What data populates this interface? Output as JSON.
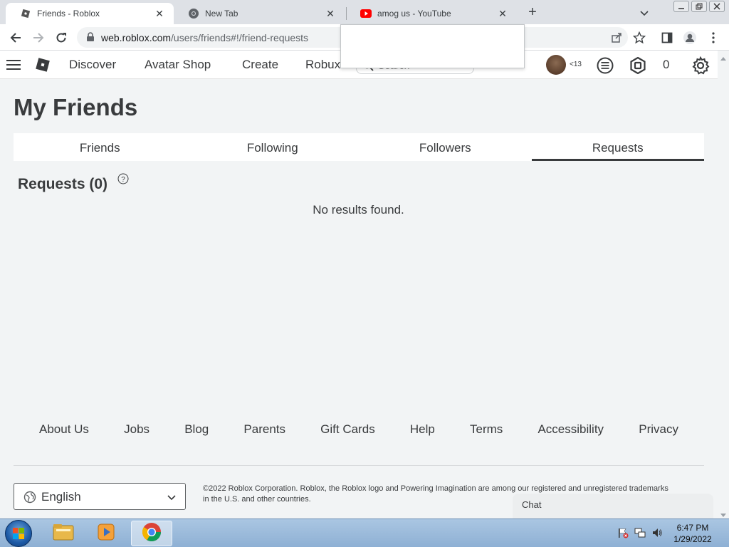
{
  "browser": {
    "tabs": [
      {
        "title": "Friends - Roblox",
        "active": true
      },
      {
        "title": "New Tab",
        "active": false
      },
      {
        "title": "amog us - YouTube",
        "active": false
      }
    ],
    "url_host": "web.roblox.com",
    "url_path": "/users/friends#!/friend-requests"
  },
  "header": {
    "nav": [
      "Discover",
      "Avatar Shop",
      "Create",
      "Robux"
    ],
    "search_placeholder": "Search",
    "age_label": "<13",
    "robux_count": "0"
  },
  "main": {
    "page_title": "My Friends",
    "tabs": [
      {
        "label": "Friends",
        "active": false
      },
      {
        "label": "Following",
        "active": false
      },
      {
        "label": "Followers",
        "active": false
      },
      {
        "label": "Requests",
        "active": true
      }
    ],
    "section_title": "Requests (0)",
    "empty_message": "No results found."
  },
  "footer": {
    "links": [
      "About Us",
      "Jobs",
      "Blog",
      "Parents",
      "Gift Cards",
      "Help",
      "Terms",
      "Accessibility",
      "Privacy"
    ],
    "language": "English",
    "copyright": "©2022 Roblox Corporation. Roblox, the Roblox logo and Powering Imagination are among our registered and unregistered trademarks in the U.S. and other countries."
  },
  "chat": {
    "label": "Chat"
  },
  "taskbar": {
    "time": "6:47 PM",
    "date": "1/29/2022"
  },
  "colors": {
    "text": "#393b3d",
    "page_bg": "#f2f4f5",
    "youtube_red": "#ff0000"
  }
}
